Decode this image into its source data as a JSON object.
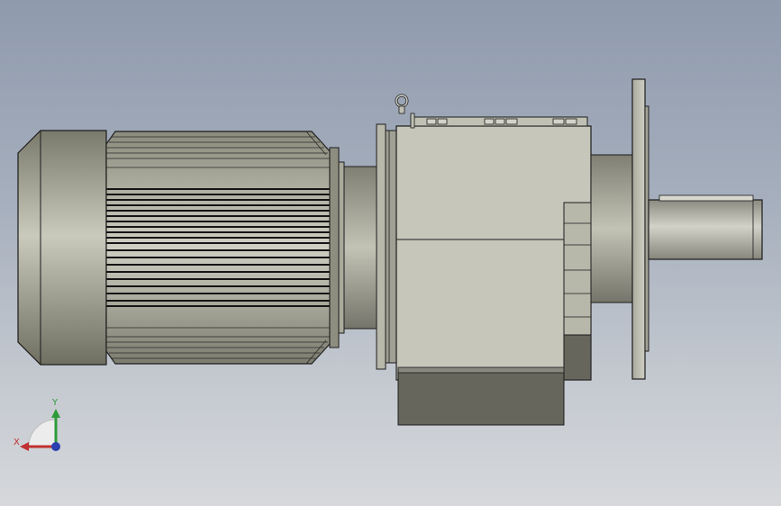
{
  "viewport": {
    "background_top": "#8f9aad",
    "background_bottom": "#d6d8db"
  },
  "model": {
    "description_icon": "gear-motor-model",
    "colors": {
      "motor_body": "#9a9a88",
      "motor_light": "#c4c4b6",
      "housing": "#c6c6bb",
      "housing_shadow": "#66665d",
      "shaft": "#b3b3a6",
      "outline": "#1c1c1c"
    }
  },
  "triad": {
    "x_label": "X",
    "y_label": "Y",
    "x_color": "#c03030",
    "y_color": "#2e9a3a",
    "z_color": "#2a3fb0"
  }
}
